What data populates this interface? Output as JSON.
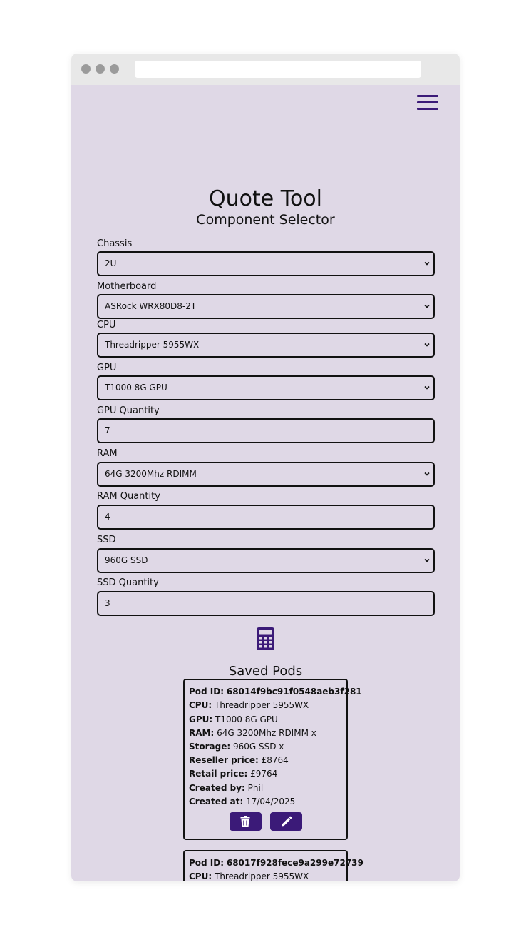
{
  "colors": {
    "accent": "#3b1a78",
    "page_background": "#dfd8e6",
    "chrome": "#e8e8e8"
  },
  "header": {
    "menu_icon": "hamburger-menu-icon"
  },
  "page": {
    "title": "Quote Tool",
    "subtitle": "Component Selector"
  },
  "form": {
    "chassis": {
      "label": "Chassis",
      "value": "2U"
    },
    "motherboard": {
      "label": "Motherboard",
      "value": "ASRock WRX80D8-2T"
    },
    "cpu": {
      "label": "CPU",
      "value": "Threadripper 5955WX"
    },
    "gpu": {
      "label": "GPU",
      "value": "T1000 8G GPU"
    },
    "gpu_quantity": {
      "label": "GPU Quantity",
      "value": "7"
    },
    "ram": {
      "label": "RAM",
      "value": "64G 3200Mhz RDIMM"
    },
    "ram_quantity": {
      "label": "RAM Quantity",
      "value": "4"
    },
    "ssd": {
      "label": "SSD",
      "value": "960G SSD"
    },
    "ssd_quantity": {
      "label": "SSD Quantity",
      "value": "3"
    },
    "calculate_icon": "calculator-icon"
  },
  "saved": {
    "title": "Saved Pods",
    "labels": {
      "pod_id": "Pod ID:",
      "cpu": "CPU:",
      "gpu": "GPU:",
      "ram": "RAM:",
      "storage": "Storage:",
      "reseller": "Reseller price:",
      "retail": "Retail price:",
      "created_by": "Created by:",
      "created_at": "Created at:"
    },
    "pods": [
      {
        "pod_id": "68014f9bc91f0548aeb3f281",
        "cpu": "Threadripper 5955WX",
        "gpu": "T1000 8G GPU",
        "ram": "64G 3200Mhz RDIMM x",
        "storage": "960G SSD x",
        "reseller_price": "£8764",
        "retail_price": "£9764",
        "created_by": "Phil",
        "created_at": "17/04/2025",
        "delete_icon": "trash-icon",
        "edit_icon": "pencil-icon"
      },
      {
        "pod_id": "68017f928fece9a299e72739",
        "cpu": "Threadripper 5955WX"
      }
    ]
  }
}
